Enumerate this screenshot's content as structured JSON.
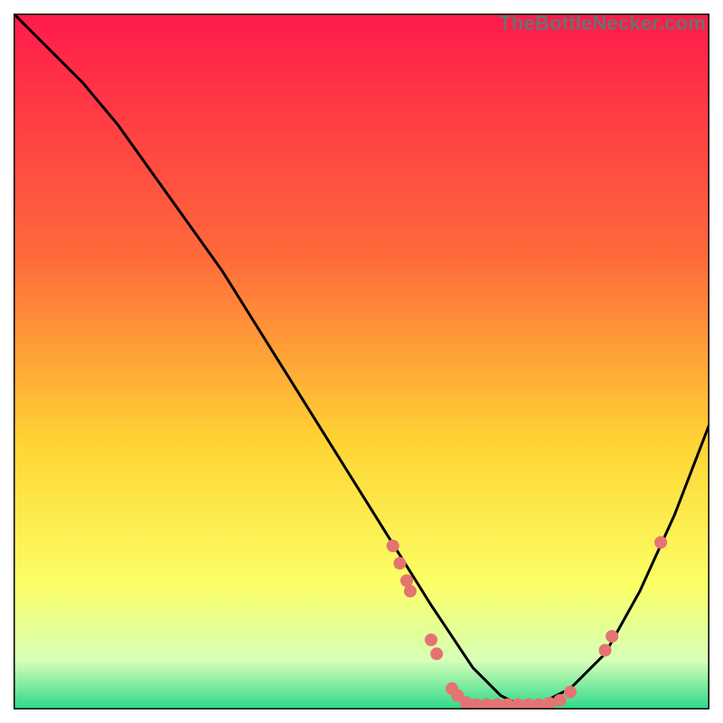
{
  "watermark": "TheBottleNecker.com",
  "colors": {
    "gradient_top": "#ff1a4b",
    "gradient_mid1": "#ff6a3a",
    "gradient_mid2": "#ffd534",
    "gradient_mid3": "#fbff66",
    "gradient_mid4": "#d6ffb7",
    "gradient_bottom": "#2bd88a",
    "curve": "#000000",
    "marker": "#e57372",
    "border": "#000000"
  },
  "chart_data": {
    "type": "line",
    "title": "",
    "xlabel": "",
    "ylabel": "",
    "xlim": [
      0,
      100
    ],
    "ylim": [
      0,
      100
    ],
    "series": [
      {
        "name": "bottleneck-curve",
        "x": [
          0,
          5,
          10,
          15,
          20,
          25,
          30,
          35,
          40,
          45,
          50,
          55,
          60,
          62,
          64,
          66,
          68,
          70,
          72,
          74,
          76,
          78,
          80,
          85,
          90,
          95,
          100
        ],
        "y": [
          100,
          95,
          90,
          84,
          77,
          70,
          63,
          55,
          47,
          39,
          31,
          23,
          15,
          12,
          9,
          6,
          4,
          2,
          1,
          1,
          1,
          2,
          3,
          8,
          17,
          28,
          41
        ]
      }
    ],
    "markers": [
      {
        "x": 54.5,
        "y": 23.5
      },
      {
        "x": 55.5,
        "y": 21.0
      },
      {
        "x": 56.5,
        "y": 18.5
      },
      {
        "x": 57.0,
        "y": 17.0
      },
      {
        "x": 60.0,
        "y": 10.0
      },
      {
        "x": 60.8,
        "y": 8.0
      },
      {
        "x": 63.0,
        "y": 3.0
      },
      {
        "x": 63.8,
        "y": 2.0
      },
      {
        "x": 65.0,
        "y": 1.0
      },
      {
        "x": 66.5,
        "y": 0.7
      },
      {
        "x": 68.0,
        "y": 0.7
      },
      {
        "x": 69.5,
        "y": 0.7
      },
      {
        "x": 71.0,
        "y": 0.7
      },
      {
        "x": 72.5,
        "y": 0.7
      },
      {
        "x": 74.0,
        "y": 0.7
      },
      {
        "x": 75.5,
        "y": 0.7
      },
      {
        "x": 77.0,
        "y": 0.9
      },
      {
        "x": 78.5,
        "y": 1.3
      },
      {
        "x": 80.0,
        "y": 2.5
      },
      {
        "x": 85.0,
        "y": 8.5
      },
      {
        "x": 86.0,
        "y": 10.5
      },
      {
        "x": 93.0,
        "y": 24.0
      }
    ]
  }
}
